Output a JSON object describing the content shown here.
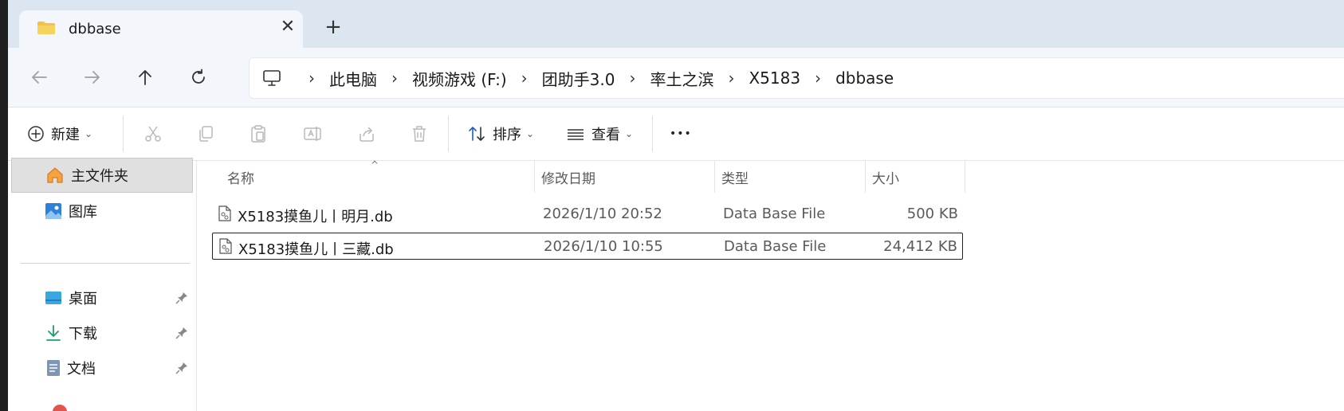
{
  "tab": {
    "title": "dbbase",
    "close_glyph": "✕",
    "newtab_glyph": "+"
  },
  "nav": {
    "back_icon": "arrow-left-icon",
    "forward_icon": "arrow-right-icon",
    "up_icon": "arrow-up-icon",
    "refresh_icon": "refresh-icon"
  },
  "breadcrumb": {
    "separator": "›",
    "items": [
      "此电脑",
      "视频游戏 (F:)",
      "团助手3.0",
      "率土之滨",
      "X5183",
      "dbbase"
    ]
  },
  "toolbar": {
    "new_label": "新建",
    "sort_label": "排序",
    "view_label": "查看",
    "more_glyph": "•••",
    "caret": "⌄"
  },
  "sidebar": {
    "items": [
      {
        "label": "主文件夹",
        "icon": "home-icon",
        "selected": true
      },
      {
        "label": "图库",
        "icon": "gallery-icon"
      },
      {
        "label": "桌面",
        "icon": "desktop-icon",
        "pinned": true
      },
      {
        "label": "下载",
        "icon": "download-icon",
        "pinned": true
      },
      {
        "label": "文档",
        "icon": "documents-icon",
        "pinned": true
      }
    ]
  },
  "columns": {
    "name": "名称",
    "date": "修改日期",
    "type": "类型",
    "size": "大小",
    "sort_glyph": "^"
  },
  "files": [
    {
      "name": "X5183摸鱼儿丨明月.db",
      "date": "2026/1/10 20:52",
      "type": "Data Base File",
      "size": "500 KB"
    },
    {
      "name": "X5183摸鱼儿丨三藏.db",
      "date": "2026/1/10 10:55",
      "type": "Data Base File",
      "size": "24,412 KB"
    }
  ],
  "colors": {
    "accent": "#0067c0",
    "titlebar": "#dbe6f0",
    "navbar": "#f3f6fa"
  }
}
